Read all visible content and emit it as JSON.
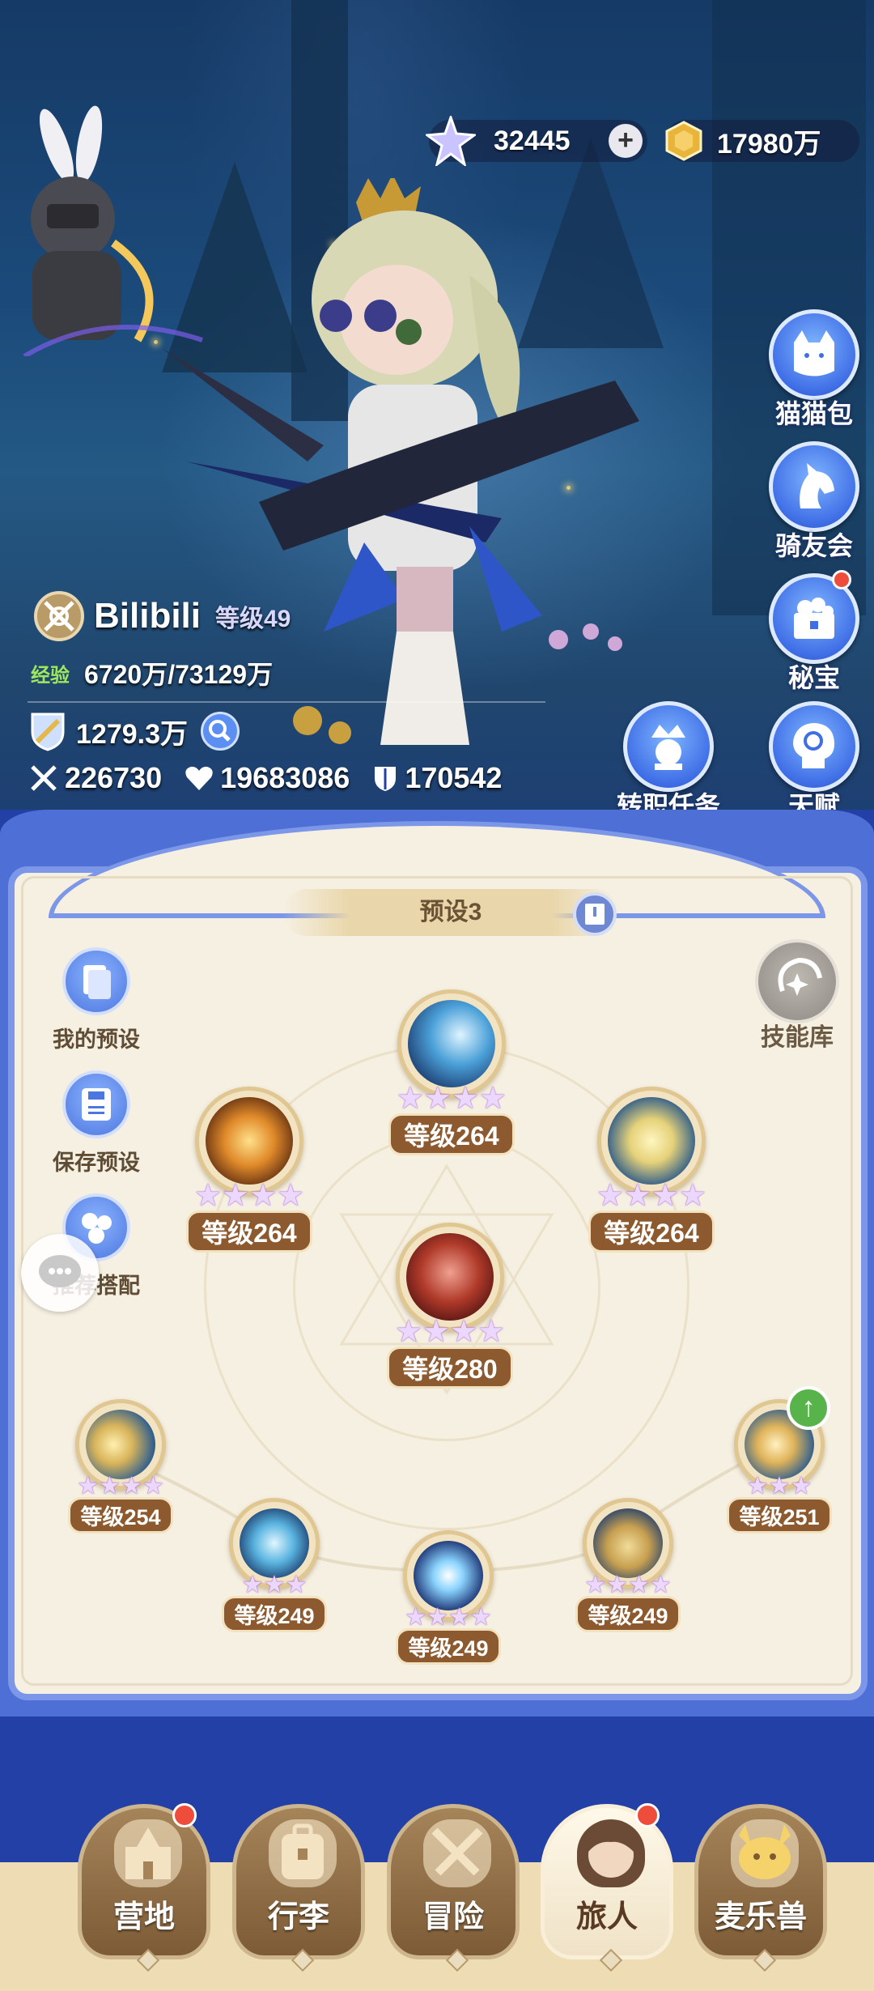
{
  "currency": {
    "gems": "32445",
    "gold": "17980万",
    "add_symbol": "+"
  },
  "side_menu": {
    "items": [
      {
        "label": "猫猫包",
        "icon": "cat-bag-icon",
        "badge": false
      },
      {
        "label": "骑友会",
        "icon": "horse-icon",
        "badge": false
      },
      {
        "label": "秘宝",
        "icon": "treasure-icon",
        "badge": true
      },
      {
        "label": "天赋",
        "icon": "brain-icon",
        "badge": false
      }
    ],
    "job_quest_label": "转职任务"
  },
  "player": {
    "name": "Bilibili",
    "level": "等级49",
    "exp_tag": "经验",
    "exp_value": "6720万/73129万",
    "power": "1279.3万",
    "attack": "226730",
    "hp": "19683086",
    "defense": "170542"
  },
  "panel": {
    "preset_name": "预设3",
    "tools": [
      {
        "label": "我的预设"
      },
      {
        "label": "保存预设"
      },
      {
        "label": "推荐搭配"
      }
    ],
    "skill_library_label": "技能库"
  },
  "skills": {
    "top": {
      "level": "等级264",
      "stars": 4
    },
    "left": {
      "level": "等级264",
      "stars": 4
    },
    "right": {
      "level": "等级264",
      "stars": 4
    },
    "center": {
      "level": "等级280",
      "stars": 4
    },
    "lower_left": {
      "level": "等级254",
      "stars": 4
    },
    "lower_right": {
      "level": "等级251",
      "stars": 3
    },
    "bottom_1": {
      "level": "等级249",
      "stars": 3
    },
    "bottom_2": {
      "level": "等级249",
      "stars": 4
    },
    "bottom_3": {
      "level": "等级249",
      "stars": 4
    }
  },
  "nav": {
    "items": [
      {
        "label": "营地",
        "badge": true
      },
      {
        "label": "行李",
        "badge": false
      },
      {
        "label": "冒险",
        "badge": false
      },
      {
        "label": "旅人",
        "badge": true,
        "active": true
      },
      {
        "label": "麦乐兽",
        "badge": false
      }
    ]
  },
  "colors": {
    "panel_bg": "#f6f0e2",
    "panel_border": "#7d97e8",
    "level_tag": "#8c5a2e",
    "badge_red": "#ef4d3c"
  }
}
